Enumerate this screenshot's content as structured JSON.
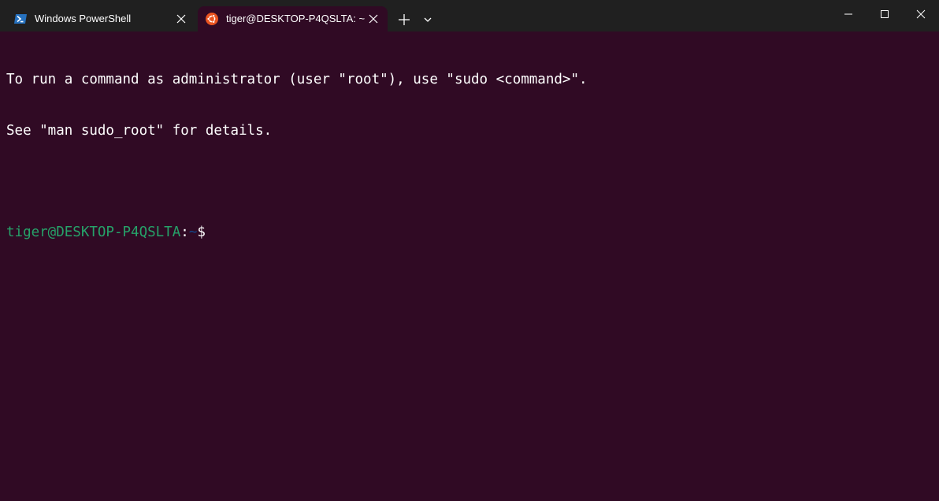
{
  "tabs": [
    {
      "title": "Windows PowerShell",
      "icon": "powershell-icon",
      "active": false
    },
    {
      "title": "tiger@DESKTOP-P4QSLTA: ~",
      "icon": "ubuntu-icon",
      "active": true
    }
  ],
  "tab_actions": {
    "new_tab_icon": "plus-icon",
    "dropdown_icon": "chevron-down-icon"
  },
  "window_controls": {
    "minimize_icon": "minimize-icon",
    "maximize_icon": "maximize-icon",
    "close_icon": "close-icon"
  },
  "terminal": {
    "lines": [
      "To run a command as administrator (user \"root\"), use \"sudo <command>\".",
      "See \"man sudo_root\" for details.",
      ""
    ],
    "prompt": {
      "user_host": "tiger@DESKTOP-P4QSLTA",
      "colon": ":",
      "path": "~",
      "symbol": "$"
    }
  },
  "colors": {
    "terminal_background": "#300a24",
    "titlebar_background": "#202020",
    "prompt_user_color": "#26a269",
    "prompt_path_color": "#12488b",
    "text_color": "#ffffff"
  }
}
